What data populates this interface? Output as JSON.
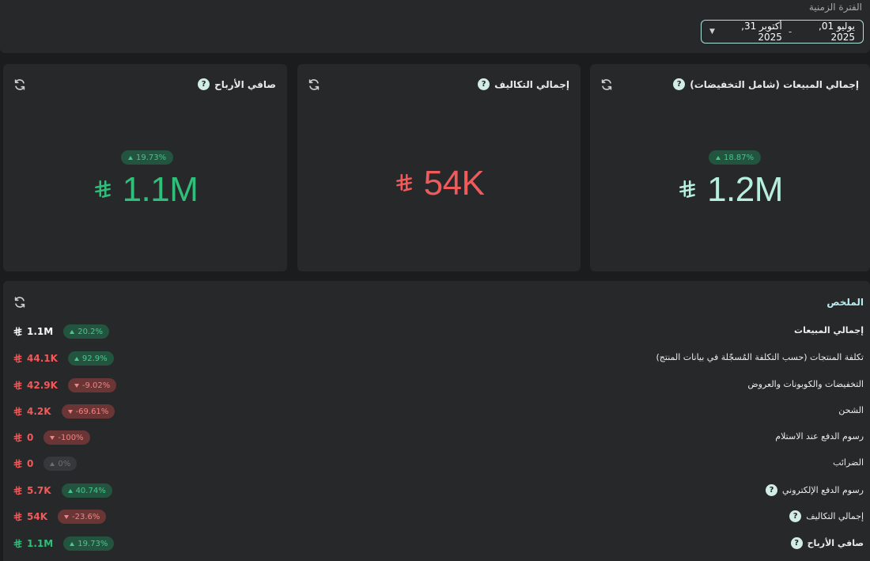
{
  "period": {
    "label": "الفترة الزمنية",
    "start": "يوليو 01, 2025",
    "separator": "-",
    "end": "أكتوبر 31, 2025"
  },
  "kpis": {
    "sales": {
      "title": "إجمالي المبيعات (شامل التخفيضات)",
      "value": "1.2M",
      "change": "18.87%",
      "color": "#b6f0dc"
    },
    "costs": {
      "title": "إجمالي التكاليف",
      "value": "54K",
      "color": "#f05a5a"
    },
    "profit": {
      "title": "صافي الأرباح",
      "value": "1.1M",
      "change": "19.73%",
      "color": "#2fbf7a"
    }
  },
  "summary": {
    "title": "الملخص",
    "rows": [
      {
        "label": "إجمالي المبيعات",
        "value": "1.1M",
        "change": "20.2%",
        "trend": "up"
      },
      {
        "label": "تكلفة المنتجات (حسب التكلفة المُسجّلة في بيانات المنتج)",
        "value": "44.1K",
        "change": "92.9%",
        "trend": "up"
      },
      {
        "label": "التخفيضات والكوبونات والعروض",
        "value": "42.9K",
        "change": "-9.02%",
        "trend": "down"
      },
      {
        "label": "الشحن",
        "value": "4.2K",
        "change": "-69.61%",
        "trend": "down"
      },
      {
        "label": "رسوم الدفع عند الاستلام",
        "value": "0",
        "change": "-100%",
        "trend": "down"
      },
      {
        "label": "الضرائب",
        "value": "0",
        "change": "0%",
        "trend": "flat"
      },
      {
        "label": "رسوم الدفع الإلكتروني",
        "value": "5.7K",
        "change": "40.74%",
        "trend": "up"
      },
      {
        "label": "إجمالي التكاليف",
        "value": "54K",
        "change": "-23.6%",
        "trend": "down"
      },
      {
        "label": "صافي الأرباح",
        "value": "1.1M",
        "change": "19.73%",
        "trend": "up"
      }
    ]
  },
  "icons": {
    "help": "?",
    "refresh": "refresh-icon",
    "currency": "riyal-icon",
    "chevron": "chevron-down-icon"
  },
  "colors": {
    "accent": "#a9e6da",
    "positive": "#2fbf7a",
    "negative": "#f05a5a",
    "panel": "#27282a",
    "background": "#1b1c1e"
  }
}
